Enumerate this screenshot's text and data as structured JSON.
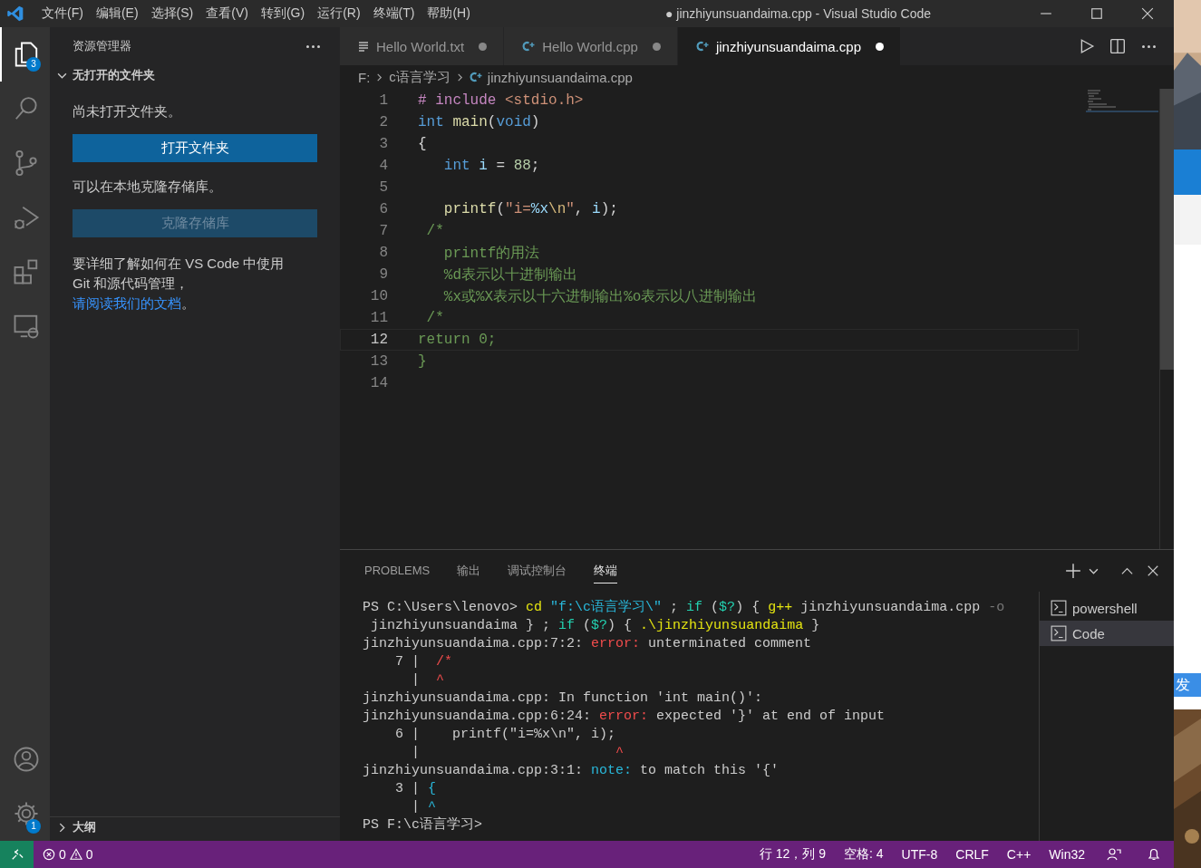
{
  "window": {
    "title": "● jinzhiyunsuandaima.cpp - Visual Studio Code"
  },
  "menu": [
    "文件(F)",
    "编辑(E)",
    "选择(S)",
    "查看(V)",
    "转到(G)",
    "运行(R)",
    "终端(T)",
    "帮助(H)"
  ],
  "activity_bar": [
    {
      "kind": "files",
      "selected": true,
      "badge": "3"
    },
    {
      "kind": "search",
      "selected": false
    },
    {
      "kind": "scm",
      "selected": false
    },
    {
      "kind": "debug",
      "selected": false
    },
    {
      "kind": "extensions",
      "selected": false
    },
    {
      "kind": "remote",
      "selected": false
    }
  ],
  "activity_bottom": [
    {
      "kind": "account"
    },
    {
      "kind": "settings",
      "badge": "1"
    }
  ],
  "sidebar": {
    "title": "资源管理器",
    "section": {
      "label": "无打开的文件夹",
      "expanded": true
    },
    "no_folder_text": "尚未打开文件夹。",
    "open_button": {
      "label": "打开文件夹",
      "disabled": false
    },
    "clone_text": "可以在本地克隆存储库。",
    "clone_button": {
      "label": "克隆存储库",
      "disabled": true
    },
    "help_text": "要详细了解如何在 VS Code 中使用 Git 和源代码管理，",
    "help_link": "请阅读我们的文档",
    "help_end": "。",
    "outline": {
      "label": "大纲",
      "expanded": false
    }
  },
  "tabs": [
    {
      "label": "Hello World.txt",
      "kind": "txt",
      "dirty": true,
      "selected": false
    },
    {
      "label": "Hello World.cpp",
      "kind": "cpp",
      "dirty": true,
      "selected": false
    },
    {
      "label": "jinzhiyunsuandaima.cpp",
      "kind": "cpp",
      "dirty": true,
      "selected": true
    }
  ],
  "breadcrumb": [
    "F:",
    "c语言学习",
    "jinzhiyunsuandaima.cpp"
  ],
  "code": [
    {
      "n": "1",
      "active": false,
      "tokens": [
        {
          "kind": "pre",
          "text": "# include "
        },
        {
          "kind": "str",
          "text": "<stdio.h>"
        }
      ]
    },
    {
      "n": "2",
      "active": false,
      "tokens": [
        {
          "kind": "kw",
          "text": "int "
        },
        {
          "kind": "func",
          "text": "main"
        },
        {
          "kind": "plain",
          "text": "("
        },
        {
          "kind": "kw",
          "text": "void"
        },
        {
          "kind": "plain",
          "text": ")"
        }
      ]
    },
    {
      "n": "3",
      "active": false,
      "tokens": [
        {
          "kind": "plain",
          "text": "{"
        }
      ]
    },
    {
      "n": "4",
      "active": false,
      "tokens": [
        {
          "kind": "kw",
          "text": "   int "
        },
        {
          "kind": "var",
          "text": "i"
        },
        {
          "kind": "plain",
          "text": " = "
        },
        {
          "kind": "num",
          "text": "88"
        },
        {
          "kind": "plain",
          "text": ";"
        }
      ]
    },
    {
      "n": "5",
      "active": false
    },
    {
      "n": "6",
      "active": false,
      "tokens": [
        {
          "kind": "func",
          "text": "   printf"
        },
        {
          "kind": "plain",
          "text": "("
        },
        {
          "kind": "str",
          "text": "\"i="
        },
        {
          "kind": "var",
          "text": "%x"
        },
        {
          "kind": "esc",
          "text": "\\n"
        },
        {
          "kind": "str",
          "text": "\""
        },
        {
          "kind": "plain",
          "text": ", "
        },
        {
          "kind": "var",
          "text": "i"
        },
        {
          "kind": "plain",
          "text": ");"
        }
      ]
    },
    {
      "n": "7",
      "active": false,
      "tokens": [
        {
          "kind": "comment",
          "text": " /*"
        }
      ]
    },
    {
      "n": "8",
      "active": false,
      "tokens": [
        {
          "kind": "comment",
          "text": "   printf的用法"
        }
      ]
    },
    {
      "n": "9",
      "active": false,
      "tokens": [
        {
          "kind": "comment",
          "text": "   %d表示以十进制输出"
        }
      ]
    },
    {
      "n": "10",
      "active": false,
      "tokens": [
        {
          "kind": "comment",
          "text": "   %x或%X表示以十六进制输出%o表示以八进制输出"
        }
      ]
    },
    {
      "n": "11",
      "active": false,
      "tokens": [
        {
          "kind": "comment",
          "text": " /*"
        }
      ]
    },
    {
      "n": "12",
      "active": true,
      "tokens": [
        {
          "kind": "comment",
          "text": "return 0;"
        }
      ]
    },
    {
      "n": "13",
      "active": false,
      "tokens": [
        {
          "kind": "comment",
          "text": "}"
        }
      ]
    },
    {
      "n": "14",
      "active": false
    }
  ],
  "panel_tabs": [
    {
      "label": "PROBLEMS",
      "selected": false
    },
    {
      "label": "输出",
      "selected": false
    },
    {
      "label": "调试控制台",
      "selected": false
    },
    {
      "label": "终端",
      "selected": true
    }
  ],
  "terminal": [
    [
      {
        "kind": "plain",
        "text": "PS C:\\Users\\lenovo> "
      },
      {
        "kind": "yellow",
        "text": "cd "
      },
      {
        "kind": "blue",
        "text": "\"f:\\c语言学习\\\""
      },
      {
        "kind": "plain",
        "text": " ; "
      },
      {
        "kind": "green",
        "text": "if"
      },
      {
        "kind": "plain",
        "text": " ("
      },
      {
        "kind": "green",
        "text": "$?"
      },
      {
        "kind": "plain",
        "text": ") { "
      },
      {
        "kind": "yellow",
        "text": "g++"
      },
      {
        "kind": "plain",
        "text": " jinzhiyunsuandaima.cpp "
      },
      {
        "kind": "dim",
        "text": "-o"
      }
    ],
    [
      {
        "kind": "plain",
        "text": " jinzhiyunsuandaima } ; "
      },
      {
        "kind": "green",
        "text": "if"
      },
      {
        "kind": "plain",
        "text": " ("
      },
      {
        "kind": "green",
        "text": "$?"
      },
      {
        "kind": "plain",
        "text": ") { "
      },
      {
        "kind": "yellow",
        "text": ".\\jinzhiyunsuandaima"
      },
      {
        "kind": "plain",
        "text": " }"
      }
    ],
    [
      {
        "kind": "plain",
        "text": "jinzhiyunsuandaima.cpp:7:2: "
      },
      {
        "kind": "red",
        "text": "error:"
      },
      {
        "kind": "plain",
        "text": " unterminated comment"
      }
    ],
    [
      {
        "kind": "plain",
        "text": "    7 |  "
      },
      {
        "kind": "red",
        "text": "/*"
      }
    ],
    [
      {
        "kind": "plain",
        "text": "      |  "
      },
      {
        "kind": "red",
        "text": "^"
      }
    ],
    [
      {
        "kind": "plain",
        "text": "jinzhiyunsuandaima.cpp: In function 'int main()':"
      }
    ],
    [
      {
        "kind": "plain",
        "text": "jinzhiyunsuandaima.cpp:6:24: "
      },
      {
        "kind": "red",
        "text": "error:"
      },
      {
        "kind": "plain",
        "text": " expected '}' at end of input"
      }
    ],
    [
      {
        "kind": "plain",
        "text": "    6 |    printf(\"i=%x\\n\", i);"
      }
    ],
    [
      {
        "kind": "plain",
        "text": "      |                        "
      },
      {
        "kind": "red",
        "text": "^"
      }
    ],
    [
      {
        "kind": "plain",
        "text": "jinzhiyunsuandaima.cpp:3:1: "
      },
      {
        "kind": "blue",
        "text": "note:"
      },
      {
        "kind": "plain",
        "text": " to match this '{'"
      }
    ],
    [
      {
        "kind": "plain",
        "text": "    3 | "
      },
      {
        "kind": "blue",
        "text": "{"
      }
    ],
    [
      {
        "kind": "plain",
        "text": "      | "
      },
      {
        "kind": "blue",
        "text": "^"
      }
    ],
    [
      {
        "kind": "plain",
        "text": "PS F:\\c语言学习>"
      }
    ]
  ],
  "terminals": [
    {
      "label": "powershell",
      "selected": false
    },
    {
      "label": "Code",
      "selected": true
    }
  ],
  "status_bar": {
    "errors": "0",
    "warnings": "0",
    "items": [
      "行 12，列 9",
      "空格: 4",
      "UTF-8",
      "CRLF",
      "C++",
      "Win32"
    ]
  },
  "background_window": {
    "button": "发"
  }
}
